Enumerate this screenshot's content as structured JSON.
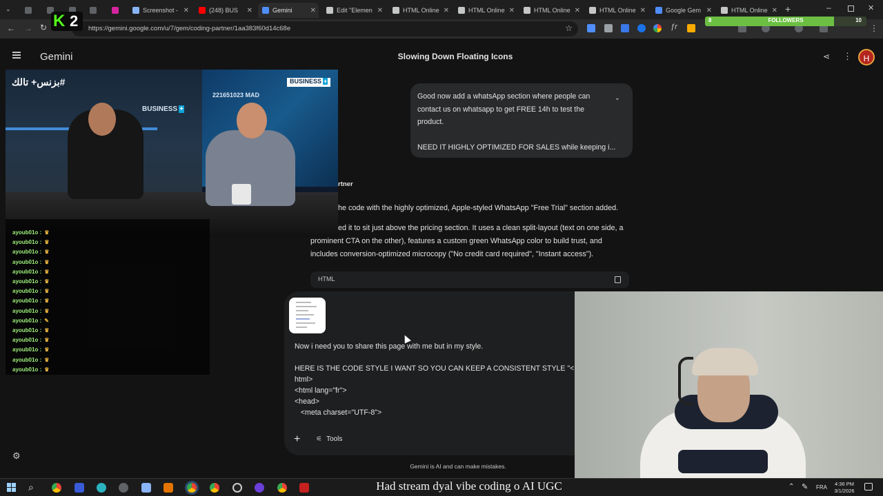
{
  "browser": {
    "tabs": [
      {
        "label": "",
        "favicon_color": "#5f6368"
      },
      {
        "label": "",
        "favicon_color": "#5f6368"
      },
      {
        "label": "",
        "favicon_color": "#5f6368"
      },
      {
        "label": "",
        "favicon_color": "#5f6368"
      },
      {
        "label": "",
        "favicon_color": "#d6249f"
      },
      {
        "label": "Screenshot -",
        "favicon_color": "#8ab4f8"
      },
      {
        "label": "(248) BUS",
        "favicon_color": "#ff0000"
      },
      {
        "label": "Gemini",
        "favicon_color": "#4f8df9"
      },
      {
        "label": "Edit \"Elemen",
        "favicon_color": "#c4c7c5"
      },
      {
        "label": "HTML Online",
        "favicon_color": "#c4c7c5"
      },
      {
        "label": "HTML Online",
        "favicon_color": "#c4c7c5"
      },
      {
        "label": "HTML Online",
        "favicon_color": "#c4c7c5"
      },
      {
        "label": "HTML Online",
        "favicon_color": "#c4c7c5"
      },
      {
        "label": "Google Gem",
        "favicon_color": "#4f8df9"
      },
      {
        "label": "HTML Online",
        "favicon_color": "#c4c7c5"
      }
    ],
    "url": "https://gemini.google.com/u/7/gem/coding-partner/1aa383f60d14c68e"
  },
  "stream_widgets": {
    "k_badge": "K",
    "k_count": "2",
    "followers_label": "FOLLOWERS",
    "followers_current": "8",
    "followers_goal": "10",
    "followers_progress": 0.8
  },
  "gemini": {
    "app_name": "Gemini",
    "chat_title": "Slowing Down Floating Icons",
    "avatar_letter": "H",
    "user_message": {
      "line1": "Good now add a whatsApp section where people can contact us on whatsapp to get FREE 14h to test the product.",
      "line2": "NEED IT HIGHLY OPTIMIZED FOR SALES while keeping i..."
    },
    "model_label": "rtner",
    "response": {
      "p1": "he code with the highly optimized, Apple-styled WhatsApp \"Free Trial\" section added.",
      "p2_start": "ed it to sit just above the pricing section. It uses a clean split-layout (text on one side, a",
      "p2_rest": "prominent CTA on the other), features a custom green WhatsApp color to build trust, and includes conversion-optimized microcopy (\"No credit card required\", \"Instant access\")."
    },
    "code_label": "HTML",
    "draft": "Now i need you to share this page with me but in my style.\n\nHERE IS THE CODE STYLE I WANT SO YOU CAN KEEP A CONSISTENT STYLE \"<!DOCT\nhtml>\n<html lang=\"fr\">\n<head>\n   <meta charset=\"UTF-8\">",
    "add_label": "+",
    "tools_label": "Tools",
    "disclaimer": "Gemini is AI and can make mistakes."
  },
  "overlay": {
    "hashtag": "#بزنس+ تالك",
    "brand_top": "BUSINESS",
    "brand_mid": "BUSINESS",
    "ticker_value": "221651023 MAD",
    "chat_user": "ayoub01o :",
    "chat_rows": 15
  },
  "taskbar": {
    "caption": "Had stream dyal vibe coding o AI UGC",
    "lang": "FRA",
    "time": "4:36 PM",
    "date": "3/1/2026"
  }
}
